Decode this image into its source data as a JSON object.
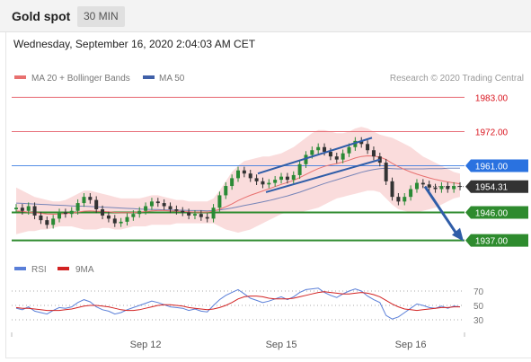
{
  "header": {
    "instrument": "Gold spot",
    "timeframe": "30 MIN"
  },
  "datetime": "Wednesday, September 16, 2020 2:04:03 AM CET",
  "legend": {
    "ma20_label": "MA 20 + Bollinger Bands",
    "ma50_label": "MA 50",
    "credit": "Research © 2020 Trading Central"
  },
  "colors": {
    "up": "#2a8a35",
    "down": "#333333",
    "ma20": "#e8706f",
    "ma50": "#4060a8",
    "bollinger": "#f8d0d0",
    "support": "#2e8b2e",
    "pivot": "#2a72e0",
    "resistance": "#e8707a",
    "rsi": "#5a7fd8",
    "rsi_ma": "#d22222",
    "trend": "#2f5da8"
  },
  "chart_data": {
    "type": "candlestick",
    "x_ticks": [
      "Sep 12",
      "Sep 15",
      "Sep 16"
    ],
    "ylim": [
      1934,
      1986
    ],
    "levels": [
      {
        "price": 1983.0,
        "label": "1983.00",
        "role": "resistance"
      },
      {
        "price": 1972.0,
        "label": "1972.00",
        "role": "resistance"
      },
      {
        "price": 1961.0,
        "label": "1961.00",
        "role": "pivot"
      },
      {
        "price": 1954.31,
        "label": "1954.31",
        "role": "last"
      },
      {
        "price": 1946.0,
        "label": "1946.00",
        "role": "support"
      },
      {
        "price": 1937.0,
        "label": "1937.00",
        "role": "support"
      }
    ],
    "closes": [
      1947.5,
      1946.5,
      1948.0,
      1945.0,
      1943.5,
      1942.0,
      1944.0,
      1946.0,
      1945.5,
      1946.5,
      1949.0,
      1951.0,
      1950.0,
      1947.0,
      1945.0,
      1944.0,
      1942.5,
      1943.0,
      1944.5,
      1945.5,
      1946.5,
      1948.0,
      1949.5,
      1949.0,
      1948.0,
      1947.0,
      1946.5,
      1946.0,
      1945.0,
      1945.5,
      1944.5,
      1944.0,
      1947.5,
      1951.5,
      1954.5,
      1957.0,
      1959.5,
      1958.5,
      1957.0,
      1956.0,
      1955.0,
      1955.5,
      1956.5,
      1957.5,
      1956.5,
      1958.0,
      1961.5,
      1964.5,
      1966.0,
      1967.0,
      1965.5,
      1964.0,
      1963.0,
      1965.0,
      1967.0,
      1969.0,
      1968.0,
      1966.0,
      1964.0,
      1962.0,
      1956.0,
      1951.0,
      1949.5,
      1951.0,
      1953.5,
      1955.5,
      1955.0,
      1954.0,
      1953.5,
      1954.5,
      1953.5,
      1954.5,
      1954.31
    ],
    "ma20": [
      1946.5,
      1946.3,
      1946.1,
      1945.9,
      1945.7,
      1945.5,
      1945.4,
      1945.5,
      1945.6,
      1945.8,
      1946.1,
      1946.4,
      1946.5,
      1946.4,
      1946.3,
      1946.2,
      1946.0,
      1945.9,
      1945.9,
      1946.0,
      1946.1,
      1946.3,
      1946.5,
      1946.6,
      1946.6,
      1946.5,
      1946.4,
      1946.3,
      1946.2,
      1946.1,
      1946.1,
      1946.1,
      1946.4,
      1947.0,
      1947.8,
      1948.7,
      1949.8,
      1950.7,
      1951.5,
      1952.2,
      1952.9,
      1953.6,
      1954.3,
      1955.0,
      1955.6,
      1956.3,
      1957.2,
      1958.2,
      1959.2,
      1960.1,
      1960.8,
      1961.3,
      1961.7,
      1962.2,
      1962.8,
      1963.5,
      1964.0,
      1964.2,
      1964.1,
      1963.8,
      1963.0,
      1961.8,
      1960.7,
      1959.8,
      1959.0,
      1958.3,
      1957.7,
      1957.1,
      1956.6,
      1956.2,
      1955.8,
      1955.5,
      1955.2
    ],
    "bb_upper": [
      1954.0,
      1953.0,
      1952.0,
      1951.0,
      1950.5,
      1950.0,
      1949.5,
      1949.5,
      1950.0,
      1951.0,
      1952.0,
      1953.0,
      1953.0,
      1952.5,
      1952.0,
      1951.5,
      1951.0,
      1950.5,
      1950.5,
      1950.5,
      1950.5,
      1951.0,
      1951.5,
      1951.5,
      1951.0,
      1950.5,
      1950.0,
      1950.0,
      1949.5,
      1949.5,
      1949.5,
      1949.5,
      1950.5,
      1953.0,
      1956.0,
      1959.0,
      1961.0,
      1962.5,
      1963.0,
      1963.5,
      1964.0,
      1964.0,
      1964.5,
      1965.0,
      1966.0,
      1967.0,
      1968.5,
      1970.0,
      1971.5,
      1972.5,
      1972.5,
      1972.0,
      1971.5,
      1971.5,
      1972.0,
      1973.0,
      1973.5,
      1973.0,
      1972.0,
      1971.0,
      1970.5,
      1970.0,
      1969.0,
      1968.0,
      1967.0,
      1965.5,
      1964.0,
      1963.0,
      1962.0,
      1961.0,
      1960.0,
      1959.0,
      1958.5
    ],
    "bb_lower": [
      1939.0,
      1939.5,
      1940.0,
      1940.0,
      1940.5,
      1940.5,
      1941.0,
      1941.5,
      1941.5,
      1941.5,
      1941.0,
      1940.5,
      1940.5,
      1940.5,
      1941.0,
      1941.0,
      1940.5,
      1940.5,
      1941.0,
      1941.5,
      1941.5,
      1941.5,
      1942.0,
      1942.0,
      1942.0,
      1942.0,
      1942.5,
      1942.5,
      1942.5,
      1942.5,
      1942.5,
      1942.5,
      1942.5,
      1941.5,
      1940.5,
      1940.0,
      1939.5,
      1940.0,
      1940.5,
      1941.5,
      1942.5,
      1943.5,
      1944.5,
      1945.5,
      1946.0,
      1946.0,
      1946.0,
      1946.5,
      1947.0,
      1947.5,
      1948.5,
      1949.5,
      1950.5,
      1951.0,
      1951.5,
      1952.0,
      1952.5,
      1953.0,
      1953.0,
      1952.5,
      1950.5,
      1948.5,
      1947.0,
      1946.5,
      1946.0,
      1946.0,
      1946.5,
      1947.0,
      1947.5,
      1948.5,
      1949.5,
      1950.5,
      1951.0
    ],
    "ma50": [
      1949.0,
      1948.9,
      1948.8,
      1948.7,
      1948.6,
      1948.5,
      1948.4,
      1948.3,
      1948.2,
      1948.1,
      1948.0,
      1948.0,
      1947.9,
      1947.8,
      1947.7,
      1947.6,
      1947.5,
      1947.4,
      1947.3,
      1947.2,
      1947.1,
      1947.0,
      1946.9,
      1946.9,
      1946.8,
      1946.8,
      1946.7,
      1946.7,
      1946.6,
      1946.6,
      1946.6,
      1946.5,
      1946.6,
      1946.8,
      1947.1,
      1947.4,
      1947.8,
      1948.2,
      1948.6,
      1949.0,
      1949.4,
      1949.8,
      1950.3,
      1950.8,
      1951.3,
      1951.9,
      1952.5,
      1953.2,
      1953.9,
      1954.6,
      1955.3,
      1955.9,
      1956.5,
      1957.1,
      1957.7,
      1958.3,
      1958.9,
      1959.4,
      1959.8,
      1960.1,
      1960.2,
      1960.1,
      1960.0,
      1960.0,
      1960.0,
      1960.0,
      1960.0,
      1960.1,
      1960.1,
      1960.1,
      1960.2,
      1960.2,
      1960.2
    ],
    "channel_upper": [
      [
        1958.5,
        1970.0
      ]
    ],
    "channel_lower": [
      [
        1952.5,
        1963.0
      ]
    ],
    "rsi_ticks": [
      30,
      50,
      70
    ],
    "rsi": [
      46,
      44,
      48,
      42,
      40,
      38,
      43,
      47,
      46,
      48,
      54,
      58,
      55,
      48,
      44,
      42,
      38,
      40,
      44,
      47,
      50,
      53,
      56,
      54,
      51,
      48,
      47,
      46,
      43,
      45,
      42,
      41,
      50,
      58,
      64,
      68,
      72,
      66,
      60,
      57,
      54,
      56,
      59,
      62,
      58,
      62,
      68,
      72,
      73,
      74,
      68,
      64,
      61,
      66,
      70,
      73,
      70,
      63,
      58,
      54,
      36,
      31,
      34,
      40,
      46,
      52,
      50,
      47,
      46,
      49,
      46,
      49,
      48
    ],
    "rsi_ma": [
      47,
      46,
      46,
      45,
      44,
      43,
      43,
      43,
      44,
      45,
      47,
      49,
      50,
      50,
      49,
      48,
      46,
      44,
      43,
      43,
      44,
      46,
      48,
      50,
      51,
      51,
      50,
      49,
      47,
      46,
      45,
      44,
      45,
      47,
      50,
      54,
      59,
      62,
      63,
      63,
      62,
      60,
      59,
      59,
      59,
      60,
      62,
      64,
      66,
      68,
      69,
      68,
      67,
      66,
      66,
      67,
      68,
      67,
      65,
      62,
      57,
      52,
      48,
      45,
      44,
      43,
      44,
      45,
      46,
      47,
      47,
      48,
      48
    ]
  }
}
